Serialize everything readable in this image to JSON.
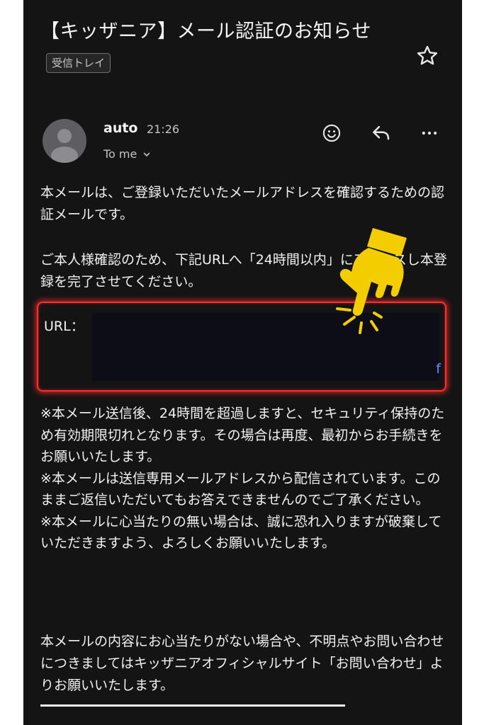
{
  "email": {
    "subject": "【キッザニア】メール認証のお知らせ",
    "folder_label": "受信トレイ",
    "sender": "auto",
    "time": "21:26",
    "recipient": "To me",
    "body_intro": "本メールは、ご登録いただいたメールアドレスを確認するための認証メールです。",
    "body_access": "ご本人様確認のため、下記URLへ「24時間以内」にアクセスし本登録を完了させてください。",
    "url_label": "URL：",
    "url_tail": "f",
    "notes": "※本メール送信後、24時間を超過しますと、セキュリティ保持のため有効期限切れとなります。その場合は再度、最初からお手続きをお願いいたします。\n ※本メールは送信専用メールアドレスから配信されています。このままご返信いただいてもお答えできませんのでご了承ください。\n ※本メールに心当たりの無い場合は、誠に恐れ入りますが破棄していただきますよう、よろしくお願いいたします。",
    "contact": " 本メールの内容にお心当たりがない場合や、不明点やお問い合わせにつきましてはキッザニアオフィシャルサイト「お問い合わせ」よりお願いいたします。"
  },
  "icons": {
    "star": "star-icon",
    "avatar": "person-avatar-icon",
    "emoji": "smiley-icon",
    "reply": "reply-icon",
    "more": "more-horizontal-icon",
    "hand": "pointing-hand-icon"
  },
  "colors": {
    "background": "#141414",
    "text": "#f2f2f2",
    "highlight_border": "#ff2e2e",
    "hand": "#f3cd00"
  }
}
